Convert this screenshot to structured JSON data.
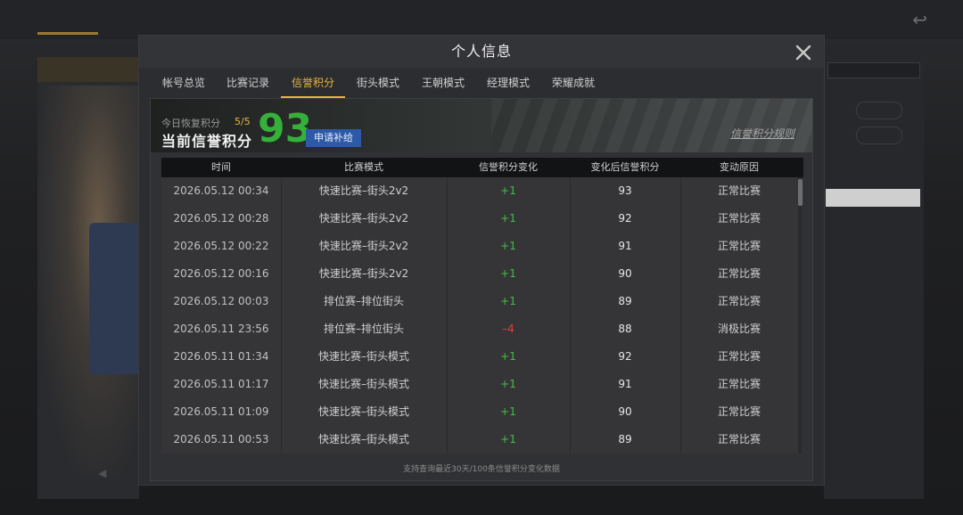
{
  "modal": {
    "title": "个人信息",
    "tabs": [
      {
        "label": "帐号总览",
        "active": false
      },
      {
        "label": "比赛记录",
        "active": false
      },
      {
        "label": "信誉积分",
        "active": true
      },
      {
        "label": "街头模式",
        "active": false
      },
      {
        "label": "王朝模式",
        "active": false
      },
      {
        "label": "经理模式",
        "active": false
      },
      {
        "label": "荣耀成就",
        "active": false
      }
    ]
  },
  "summary": {
    "today_label": "今日恢复积分",
    "today_value": "5/5",
    "current_label": "当前信誉积分",
    "current_score": "93",
    "apply_button": "申请补给",
    "rules_link": "信誉积分规则"
  },
  "table": {
    "headers": [
      "时间",
      "比赛模式",
      "信誉积分变化",
      "变化后信誉积分",
      "变动原因"
    ],
    "rows": [
      {
        "time": "2026.05.12  00:34",
        "mode": "快速比赛–街头2v2",
        "change": "+1",
        "after": "93",
        "reason": "正常比赛"
      },
      {
        "time": "2026.05.12  00:28",
        "mode": "快速比赛–街头2v2",
        "change": "+1",
        "after": "92",
        "reason": "正常比赛"
      },
      {
        "time": "2026.05.12  00:22",
        "mode": "快速比赛–街头2v2",
        "change": "+1",
        "after": "91",
        "reason": "正常比赛"
      },
      {
        "time": "2026.05.12  00:16",
        "mode": "快速比赛–街头2v2",
        "change": "+1",
        "after": "90",
        "reason": "正常比赛"
      },
      {
        "time": "2026.05.12  00:03",
        "mode": "排位赛–排位街头",
        "change": "+1",
        "after": "89",
        "reason": "正常比赛"
      },
      {
        "time": "2026.05.11  23:56",
        "mode": "排位赛–排位街头",
        "change": "–4",
        "after": "88",
        "reason": "消极比赛"
      },
      {
        "time": "2026.05.11  01:34",
        "mode": "快速比赛–街头模式",
        "change": "+1",
        "after": "92",
        "reason": "正常比赛"
      },
      {
        "time": "2026.05.11  01:17",
        "mode": "快速比赛–街头模式",
        "change": "+1",
        "after": "91",
        "reason": "正常比赛"
      },
      {
        "time": "2026.05.11  01:09",
        "mode": "快速比赛–街头模式",
        "change": "+1",
        "after": "90",
        "reason": "正常比赛"
      },
      {
        "time": "2026.05.11  00:53",
        "mode": "快速比赛–街头模式",
        "change": "+1",
        "after": "89",
        "reason": "正常比赛"
      }
    ],
    "footer_note": "支持查询最近30天/100条信誉积分变化数据"
  },
  "colors": {
    "accent_gold": "#e6b640",
    "score_green": "#35b03a",
    "positive": "#3fbf3f",
    "negative": "#e04040",
    "button_blue": "#2d5aa8"
  },
  "icons": {
    "close": "close-icon"
  }
}
